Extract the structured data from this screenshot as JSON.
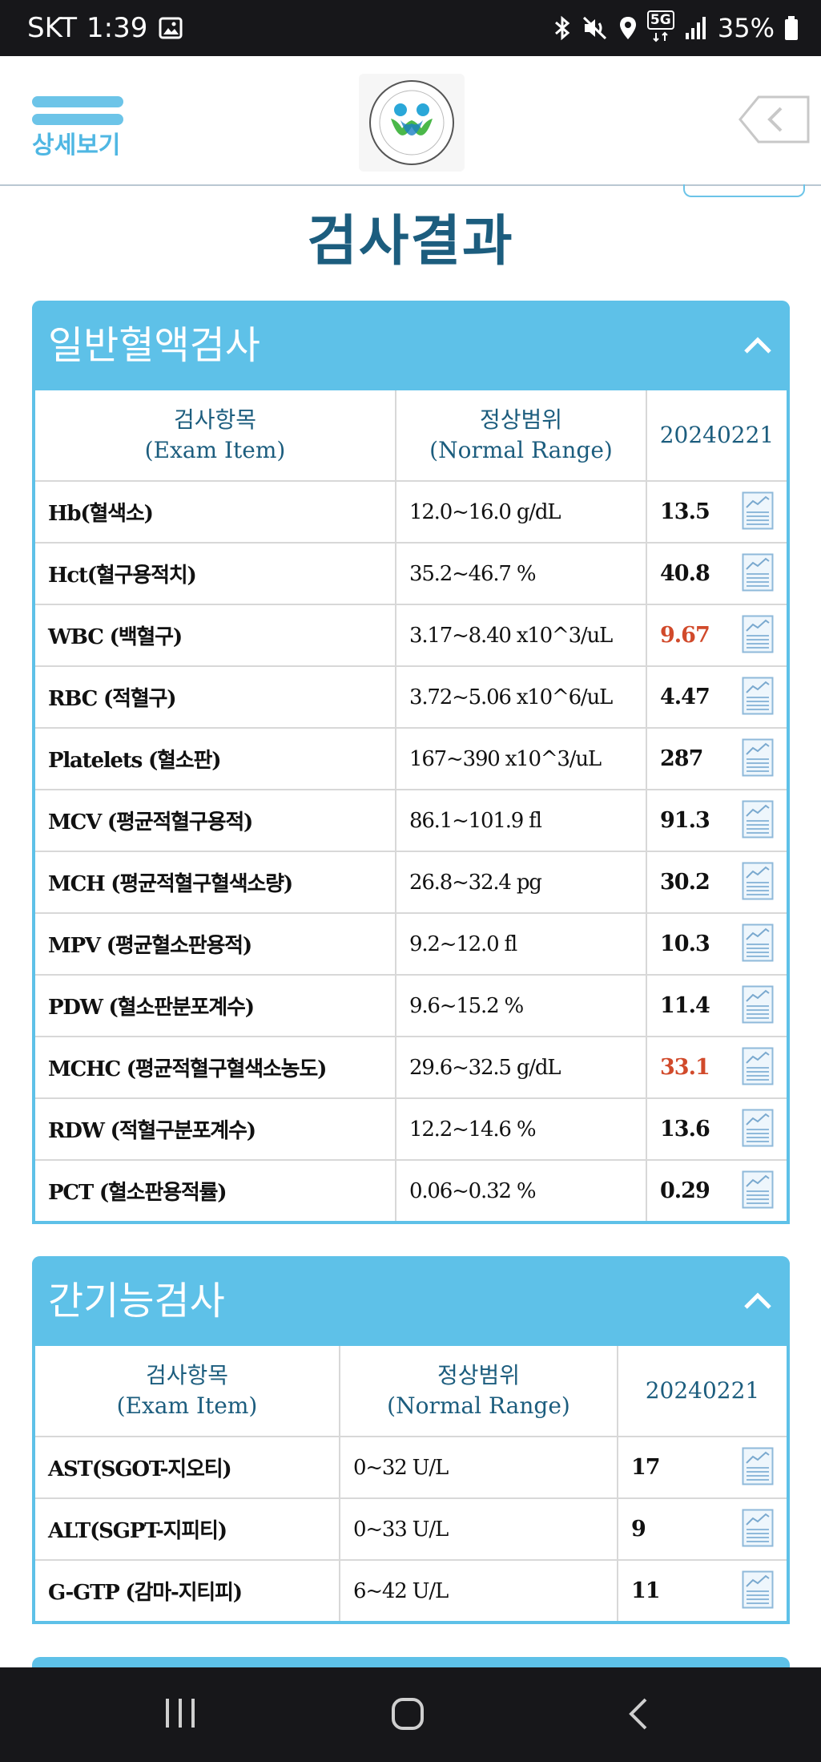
{
  "status_bar": {
    "carrier": "SKT",
    "time": "1:39",
    "network": "5G",
    "battery": "35%"
  },
  "header": {
    "menu_label": "상세보기"
  },
  "page_title": "검사결과",
  "sections": [
    {
      "title": "일반혈액검사",
      "columns": {
        "item_ko": "검사항목",
        "item_en": "(Exam Item)",
        "range_ko": "정상범위",
        "range_en": "(Normal Range)",
        "date": "20240221"
      },
      "rows": [
        {
          "item": "Hb(혈색소)",
          "range": "12.0~16.0 g/dL",
          "value": "13.5"
        },
        {
          "item": "Hct(혈구용적치)",
          "range": "35.2~46.7 %",
          "value": "40.8"
        },
        {
          "item": "WBC (백혈구)",
          "range": "3.17~8.40 x10^3/uL",
          "value": "9.67"
        },
        {
          "item": "RBC (적혈구)",
          "range": "3.72~5.06 x10^6/uL",
          "value": "4.47"
        },
        {
          "item": "Platelets (혈소판)",
          "range": "167~390 x10^3/uL",
          "value": "287"
        },
        {
          "item": "MCV (평균적혈구용적)",
          "range": "86.1~101.9 fl",
          "value": "91.3"
        },
        {
          "item": "MCH (평균적혈구혈색소량)",
          "range": "26.8~32.4 pg",
          "value": "30.2"
        },
        {
          "item": "MPV (평균혈소판용적)",
          "range": "9.2~12.0 fl",
          "value": "10.3"
        },
        {
          "item": "PDW (혈소판분포계수)",
          "range": "9.6~15.2 %",
          "value": "11.4"
        },
        {
          "item": "MCHC (평균적혈구혈색소농도)",
          "range": "29.6~32.5 g/dL",
          "value": "33.1"
        },
        {
          "item": "RDW (적혈구분포계수)",
          "range": "12.2~14.6 %",
          "value": "13.6"
        },
        {
          "item": "PCT (혈소판용적률)",
          "range": "0.06~0.32 %",
          "value": "0.29"
        }
      ]
    },
    {
      "title": "간기능검사",
      "columns": {
        "item_ko": "검사항목",
        "item_en": "(Exam Item)",
        "range_ko": "정상범위",
        "range_en": "(Normal Range)",
        "date": "20240221"
      },
      "rows": [
        {
          "item": "AST(SGOT-지오티)",
          "range": "0~32 U/L",
          "value": "17"
        },
        {
          "item": "ALT(SGPT-지피티)",
          "range": "0~33 U/L",
          "value": "9"
        },
        {
          "item": "G-GTP (감마-지티피)",
          "range": "6~42 U/L",
          "value": "11"
        }
      ]
    }
  ],
  "colors": {
    "accent": "#5ec1e8",
    "title": "#1c5d7e",
    "out_of_range": "#d14a2b",
    "status_bar": "#17171a"
  }
}
